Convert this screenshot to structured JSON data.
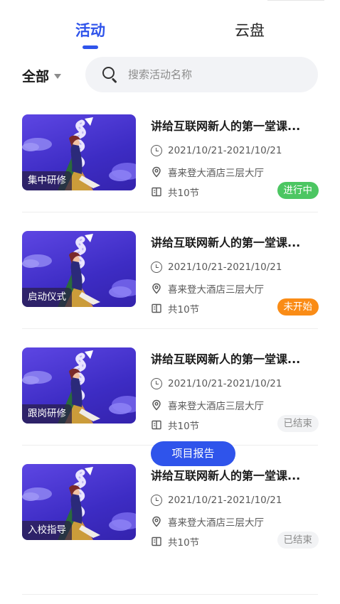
{
  "tabs": [
    {
      "label": "活动",
      "active": true
    },
    {
      "label": "云盘",
      "active": false
    }
  ],
  "filter": {
    "label": "全部",
    "icon": "caret-down-icon"
  },
  "search": {
    "placeholder": "搜索活动名称",
    "value": "",
    "icon": "search-icon"
  },
  "activities": [
    {
      "tag": "集中研修",
      "title": "讲给互联网新人的第一堂课...",
      "date": "2021/10/21-2021/10/21",
      "location": "喜来登大酒店三层大厅",
      "sessions": "共10节",
      "status": "进行中",
      "status_type": "ongoing"
    },
    {
      "tag": "启动仪式",
      "title": "讲给互联网新人的第一堂课...",
      "date": "2021/10/21-2021/10/21",
      "location": "喜来登大酒店三层大厅",
      "sessions": "共10节",
      "status": "未开始",
      "status_type": "pending"
    },
    {
      "tag": "跟岗研修",
      "title": "讲给互联网新人的第一堂课...",
      "date": "2021/10/21-2021/10/21",
      "location": "喜来登大酒店三层大厅",
      "sessions": "共10节",
      "status": "已结束",
      "status_type": "ended"
    },
    {
      "tag": "入校指导",
      "title": "讲给互联网新人的第一堂课...",
      "date": "2021/10/21-2021/10/21",
      "location": "喜来登大酒店三层大厅",
      "sessions": "共10节",
      "status": "已结束",
      "status_type": "ended",
      "action_label": "项目报告"
    }
  ],
  "colors": {
    "accent": "#2f54eb",
    "ongoing": "#4cc662",
    "pending": "#fa8c16",
    "ended_bg": "#f2f3f5"
  }
}
